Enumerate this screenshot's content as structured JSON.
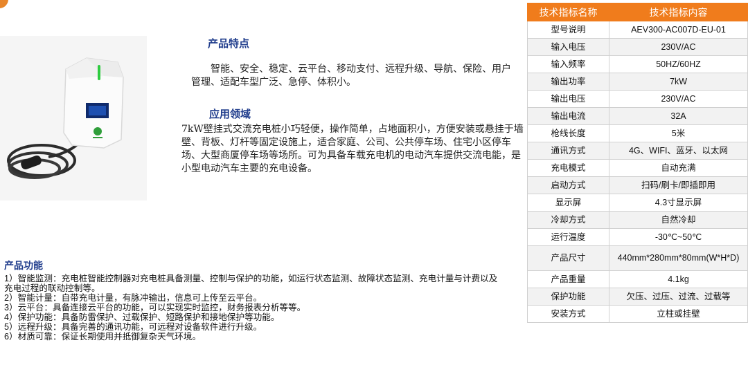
{
  "features": {
    "title": "产品特点",
    "text": "智能、安全、稳定、云平台、移动支付、远程升级、导航、保险、用户管理、适配车型广泛、急停、体积小。"
  },
  "application": {
    "title": "应用领域",
    "text": "7kW壁挂式交流充电桩小巧轻便，操作简单，占地面积小，方便安装或悬挂于墙壁、背板、灯杆等固定设施上，适合家庭、公司、公共停车场、住宅小区停车场、大型商厦停车场等场所。可为具备车载充电机的电动汽车提供交流电能，是小型电动汽车主要的充电设备。"
  },
  "functions": {
    "title": "产品功能",
    "items": [
      "1）智能监测：充电桩智能控制器对充电桩具备测量、控制与保护的功能，如运行状态监测、故障状态监测、充电计量与计费以及充电过程的联动控制等。",
      "2）智能计量：自带充电计量，有脉冲输出，信息可上传至云平台。",
      "3）云平台：具备连接云平台的功能，可以实现实时监控，财务报表分析等等。",
      "4）保护功能：具备防雷保护、过载保护、短路保护和接地保护等功能。",
      "5）远程升级：具备完善的通讯功能，可远程对设备软件进行升级。",
      "6）材质可靠：保证长期使用并抵御复杂天气环境。"
    ]
  },
  "spec_table": {
    "headers": [
      "技术指标名称",
      "技术指标内容"
    ],
    "rows": [
      [
        "型号说明",
        "AEV300-AC007D-EU-01"
      ],
      [
        "输入电压",
        "230V/AC"
      ],
      [
        "输入频率",
        "50HZ/60HZ"
      ],
      [
        "输出功率",
        "7kW"
      ],
      [
        "输出电压",
        "230V/AC"
      ],
      [
        "输出电流",
        "32A"
      ],
      [
        "枪线长度",
        "5米"
      ],
      [
        "通讯方式",
        "4G、WIFI、蓝牙、以太网"
      ],
      [
        "充电模式",
        "自动充满"
      ],
      [
        "启动方式",
        "扫码/刷卡/即插即用"
      ],
      [
        "显示屏",
        "4.3寸显示屏"
      ],
      [
        "冷却方式",
        "自然冷却"
      ],
      [
        "运行温度",
        "-30℃~50℃"
      ],
      [
        "产品尺寸",
        "440mm*280mm*80mm(W*H*D)"
      ],
      [
        "产品重量",
        "4.1kg"
      ],
      [
        "保护功能",
        "欠压、过压、过流、过载等"
      ],
      [
        "安装方式",
        "立柱或挂壁"
      ]
    ]
  },
  "colors": {
    "header_bg": "#f07c1c",
    "heading_text": "#1f3c8c",
    "accent_green": "#2ecc40"
  },
  "icons": {
    "product_image": "ev-wall-charger-image",
    "corner_mark": "orange-circle-mark"
  }
}
